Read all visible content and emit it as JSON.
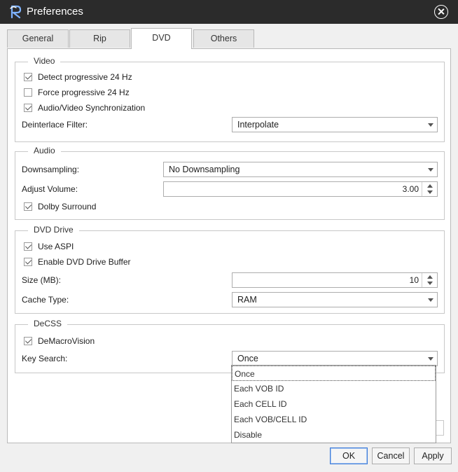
{
  "window": {
    "title": "Preferences"
  },
  "tabs": [
    {
      "label": "General"
    },
    {
      "label": "Rip"
    },
    {
      "label": "DVD"
    },
    {
      "label": "Others"
    }
  ],
  "video": {
    "title": "Video",
    "detect_progressive": {
      "label": "Detect progressive 24 Hz",
      "checked": true
    },
    "force_progressive": {
      "label": "Force progressive 24 Hz",
      "checked": false
    },
    "av_sync": {
      "label": "Audio/Video Synchronization",
      "checked": true
    },
    "deinterlace": {
      "label": "Deinterlace Filter:",
      "value": "Interpolate"
    }
  },
  "audio": {
    "title": "Audio",
    "downsampling": {
      "label": "Downsampling:",
      "value": "No Downsampling"
    },
    "adjust_volume": {
      "label": "Adjust Volume:",
      "value": "3.00"
    },
    "dolby": {
      "label": "Dolby Surround",
      "checked": true
    }
  },
  "dvd_drive": {
    "title": "DVD Drive",
    "use_aspi": {
      "label": "Use ASPI",
      "checked": true
    },
    "drive_buffer": {
      "label": "Enable DVD Drive Buffer",
      "checked": true
    },
    "size": {
      "label": "Size (MB):",
      "value": "10"
    },
    "cache_type": {
      "label": "Cache Type:",
      "value": "RAM"
    }
  },
  "decss": {
    "title": "DeCSS",
    "demacrovision": {
      "label": "DeMacroVision",
      "checked": true
    },
    "key_search": {
      "label": "Key Search:",
      "value": "Once",
      "options": [
        "Once",
        "Each VOB ID",
        "Each CELL ID",
        "Each VOB/CELL ID",
        "Disable"
      ],
      "selected_index": 0
    }
  },
  "buttons": {
    "ok": "OK",
    "cancel": "Cancel",
    "apply": "Apply"
  },
  "colors": {
    "titlebar": "#2b2b2b",
    "accent": "#3d7bd9"
  }
}
